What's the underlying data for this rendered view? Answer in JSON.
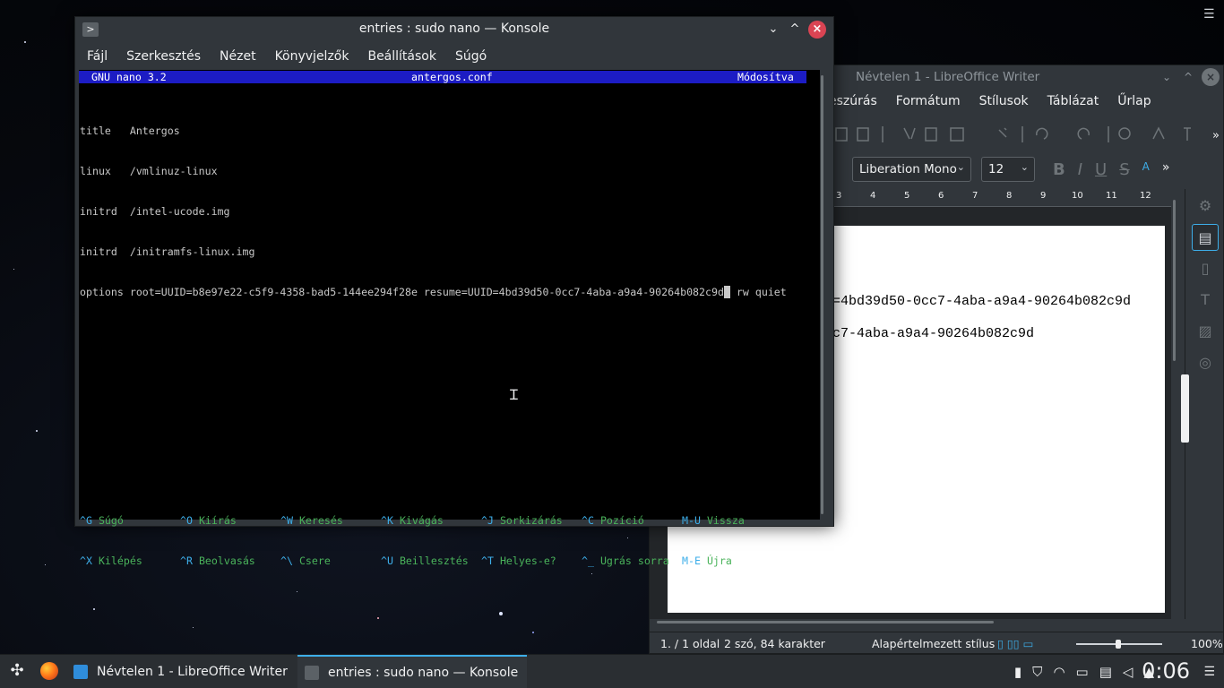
{
  "konsole": {
    "title": "entries : sudo nano — Konsole",
    "menu": [
      "Fájl",
      "Szerkesztés",
      "Nézet",
      "Könyvjelzők",
      "Beállítások",
      "Súgó"
    ],
    "nano": {
      "version": "GNU nano 3.2",
      "filename": "antergos.conf",
      "status": "Módosítva",
      "lines": [
        "title   Antergos",
        "linux   /vmlinuz-linux",
        "initrd  /intel-ucode.img",
        "initrd  /initramfs-linux.img"
      ],
      "options_before_cursor": "options root=UUID=b8e97e22-c5f9-4358-bad5-144ee294f28e resume=UUID=4bd39d50-0cc7-4aba-a9a4-90264b082c9d",
      "options_after_cursor": " rw quiet",
      "shortcuts_row1": [
        {
          "key": "^G",
          "label": "Súgó"
        },
        {
          "key": "^O",
          "label": "Kiírás"
        },
        {
          "key": "^W",
          "label": "Keresés"
        },
        {
          "key": "^K",
          "label": "Kivágás"
        },
        {
          "key": "^J",
          "label": "Sorkizárás"
        },
        {
          "key": "^C",
          "label": "Pozíció"
        },
        {
          "key": "M-U",
          "label": "Vissza"
        }
      ],
      "shortcuts_row2": [
        {
          "key": "^X",
          "label": "Kilépés"
        },
        {
          "key": "^R",
          "label": "Beolvasás"
        },
        {
          "key": "^\\",
          "label": "Csere"
        },
        {
          "key": "^U",
          "label": "Beillesztés"
        },
        {
          "key": "^T",
          "label": "Helyes-e?"
        },
        {
          "key": "^_",
          "label": "Ugrás sorra"
        },
        {
          "key": "M-E",
          "label": "Újra"
        }
      ]
    }
  },
  "writer": {
    "title": "Névtelen 1 - LibreOffice Writer",
    "menu": [
      "eszúrás",
      "Formátum",
      "Stílusok",
      "Táblázat",
      "Űrlap"
    ],
    "font_name": "Liberation Mono",
    "font_size": "12",
    "ruler_ticks": [
      "3",
      "4",
      "5",
      "6",
      "7",
      "8",
      "9",
      "10",
      "11",
      "12"
    ],
    "doc_line1": "=4bd39d50-0cc7-4aba-a9a4-90264b082c9d",
    "doc_line2": "c7-4aba-a9a4-90264b082c9d",
    "status": {
      "page": "1. / 1 oldal",
      "words": "2 szó, 84 karakter",
      "style": "Alapértelmezett stílus",
      "zoom": "100%"
    }
  },
  "taskbar": {
    "tasks": [
      {
        "label": "Névtelen 1 - LibreOffice Writer",
        "icon": "libreoffice-writer-icon",
        "active": false
      },
      {
        "label": "entries : sudo nano — Konsole",
        "icon": "konsole-icon",
        "active": true
      }
    ],
    "clock": "0:06"
  },
  "colors": {
    "nano_header": "#1c1cc4",
    "nano_shortcut_label": "#4ab35b",
    "nano_shortcut_key": "#3daee9",
    "close_button": "#da4453",
    "accent": "#3daee9"
  }
}
